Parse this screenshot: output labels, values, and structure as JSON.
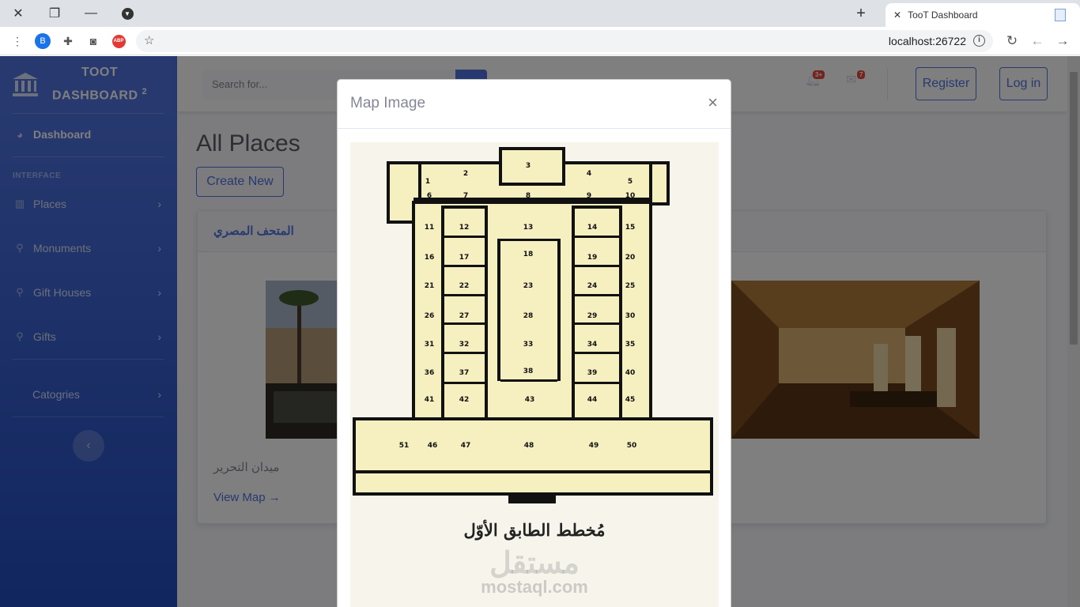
{
  "browser": {
    "tab_title": "TooT Dashboard",
    "url": "localhost:26722"
  },
  "sidebar": {
    "brand_line1": "TOOT",
    "brand_line2": "DASHBOARD",
    "brand_sup": "2",
    "dashboard": "Dashboard",
    "heading": "INTERFACE",
    "items": [
      {
        "label": "Places"
      },
      {
        "label": "Monuments"
      },
      {
        "label": "Gift Houses"
      },
      {
        "label": "Gifts"
      },
      {
        "label": "Catogries"
      }
    ]
  },
  "topbar": {
    "search_placeholder": "Search for...",
    "alerts_badge": "3+",
    "messages_badge": "7",
    "register": "Register",
    "login": "Log in"
  },
  "main": {
    "title": "All Places",
    "create_new": "Create New",
    "card_header": "المتحف المصري",
    "place_name": "ميدان التحرير",
    "view_map": "View Map →"
  },
  "modal": {
    "title": "Map Image",
    "close": "×",
    "caption": "مُخطط الطابق الأوّل",
    "watermark_ar": "مستقل",
    "watermark_en": "mostaql.com",
    "room_labels": [
      "1",
      "2",
      "3",
      "4",
      "5",
      "6",
      "7",
      "8",
      "9",
      "10",
      "11",
      "12",
      "13",
      "14",
      "15",
      "16",
      "17",
      "18",
      "19",
      "20",
      "21",
      "22",
      "23",
      "24",
      "25",
      "26",
      "27",
      "28",
      "29",
      "30",
      "31",
      "32",
      "33",
      "34",
      "35",
      "36",
      "37",
      "38",
      "39",
      "40",
      "41",
      "42",
      "43",
      "44",
      "45",
      "46",
      "47",
      "48",
      "49",
      "50",
      "51"
    ]
  }
}
